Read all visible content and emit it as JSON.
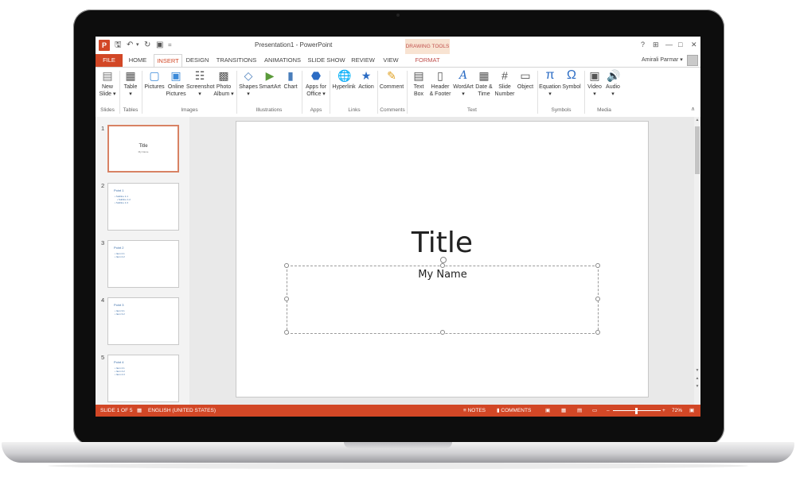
{
  "window": {
    "title": "Presentation1 - PowerPoint",
    "contextual_group": "DRAWING TOOLS",
    "controls": [
      "?",
      "⊞",
      "—",
      "□",
      "✕"
    ]
  },
  "quick_access": {
    "save_icon": "save-icon",
    "undo_icon": "undo-icon",
    "redo_icon": "redo-icon",
    "present_icon": "present-icon",
    "customize": "="
  },
  "tabs": [
    {
      "label": "FILE"
    },
    {
      "label": "HOME"
    },
    {
      "label": "INSERT"
    },
    {
      "label": "DESIGN"
    },
    {
      "label": "TRANSITIONS"
    },
    {
      "label": "ANIMATIONS"
    },
    {
      "label": "SLIDE SHOW"
    },
    {
      "label": "REVIEW"
    },
    {
      "label": "VIEW"
    },
    {
      "label": "FORMAT"
    }
  ],
  "active_tab": "INSERT",
  "user": {
    "name": "Amirali Parmar",
    "chevron": "▾"
  },
  "ribbon": {
    "buttons": [
      {
        "line1": "New",
        "line2": "Slide ▾"
      },
      {
        "line1": "Table",
        "line2": "▾"
      },
      {
        "line1": "Pictures",
        "line2": ""
      },
      {
        "line1": "Online",
        "line2": "Pictures"
      },
      {
        "line1": "Screenshot",
        "line2": "▾"
      },
      {
        "line1": "Photo",
        "line2": "Album ▾"
      },
      {
        "line1": "Shapes",
        "line2": "▾"
      },
      {
        "line1": "SmartArt",
        "line2": ""
      },
      {
        "line1": "Chart",
        "line2": ""
      },
      {
        "line1": "Apps for",
        "line2": "Office ▾"
      },
      {
        "line1": "Hyperlink",
        "line2": ""
      },
      {
        "line1": "Action",
        "line2": ""
      },
      {
        "line1": "Comment",
        "line2": ""
      },
      {
        "line1": "Text",
        "line2": "Box"
      },
      {
        "line1": "Header",
        "line2": "& Footer"
      },
      {
        "line1": "WordArt",
        "line2": "▾"
      },
      {
        "line1": "Date &",
        "line2": "Time"
      },
      {
        "line1": "Slide",
        "line2": "Number"
      },
      {
        "line1": "Object",
        "line2": ""
      },
      {
        "line1": "Equation",
        "line2": "▾"
      },
      {
        "line1": "Symbol",
        "line2": ""
      },
      {
        "line1": "Video",
        "line2": "▾"
      },
      {
        "line1": "Audio",
        "line2": "▾"
      }
    ],
    "groups": [
      "Slides",
      "Tables",
      "Images",
      "Illustrations",
      "Apps",
      "Links",
      "Comments",
      "Text",
      "Symbols",
      "Media"
    ],
    "collapse": "∧"
  },
  "thumbnails": [
    {
      "number": "1",
      "title": "Title",
      "subtitle": "My Name"
    },
    {
      "number": "2",
      "title": "Point 1",
      "bullets": [
        "• Subline 1.1",
        "• Subline 1.2",
        "• Subline 1.3"
      ]
    },
    {
      "number": "3",
      "title": "Point 2",
      "bullets": [
        "• Item 2.1",
        "• Item 2.2"
      ]
    },
    {
      "number": "4",
      "title": "Point 3",
      "bullets": [
        "• Item 3.1",
        "• Item 3.2"
      ]
    },
    {
      "number": "5",
      "title": "Point 4",
      "bullets": [
        "• Item 4.1",
        "• Item 4.2",
        "• Item 4.3"
      ]
    }
  ],
  "slide": {
    "title": "Title",
    "subtitle": "My Name"
  },
  "statusbar": {
    "slide_info": "SLIDE 1 OF 5",
    "language": "ENGLISH (UNITED STATES)",
    "notes": "NOTES",
    "comments": "COMMENTS",
    "zoom_minus": "–",
    "zoom_plus": "+",
    "zoom": "72%"
  },
  "colors": {
    "accent": "#d24726",
    "format_tab": "#c0504d",
    "thumb_text": "#3b6ea8"
  }
}
